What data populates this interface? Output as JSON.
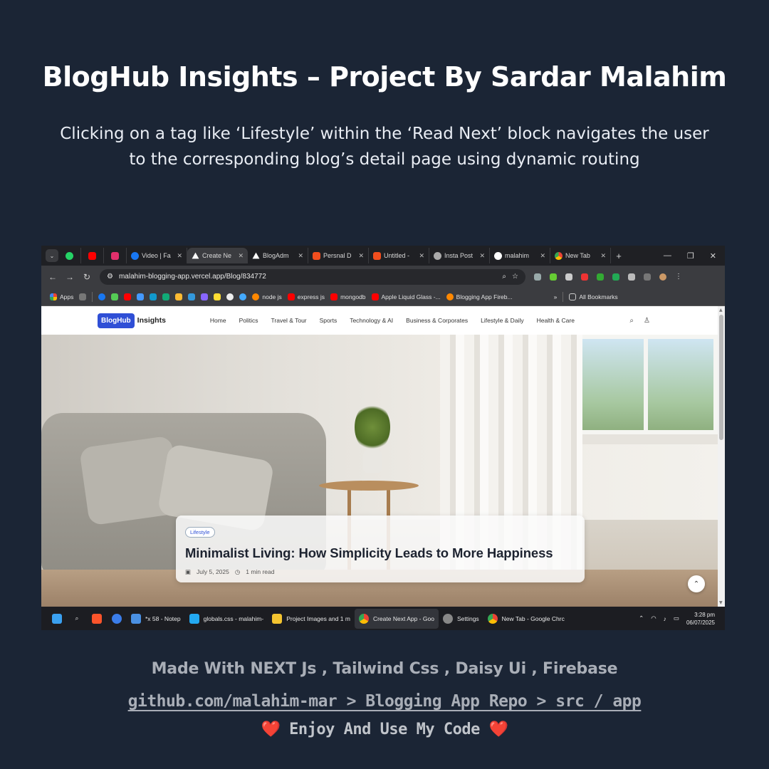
{
  "poster": {
    "title": "BlogHub Insights – Project By Sardar Malahim",
    "subtitle": "Clicking on a tag like ‘Lifestyle’ within the ‘Read Next’ block navigates the user to the corresponding blog’s detail page using dynamic routing",
    "stack_line": "Made With NEXT Js , Tailwind Css  , Daisy Ui , Firebase",
    "repo_path": "github.com/malahim-mar > Blogging App Repo > src / app",
    "enjoy_text": "Enjoy And Use My Code",
    "heart": "❤️"
  },
  "browser": {
    "tabs": [
      {
        "label": "",
        "icon": "whatsapp-icon",
        "color": "#25d366"
      },
      {
        "label": "",
        "icon": "youtube-icon",
        "color": "#ff0000"
      },
      {
        "label": "",
        "icon": "instagram-icon",
        "color": "#e1306c"
      },
      {
        "label": "Video | Fa",
        "icon": "facebook-icon",
        "color": "#1877f2"
      },
      {
        "label": "Create Ne",
        "icon": "vercel-icon",
        "color": "#000000",
        "active": true
      },
      {
        "label": "BlogAdm",
        "icon": "vercel-icon",
        "color": "#000000"
      },
      {
        "label": "Persnal D",
        "icon": "figma-icon",
        "color": "#f24e1e"
      },
      {
        "label": "Untitled -",
        "icon": "figma-icon",
        "color": "#f24e1e"
      },
      {
        "label": "Insta Post",
        "icon": "threads-icon",
        "color": "#aaaaaa"
      },
      {
        "label": "malahim",
        "icon": "github-icon",
        "color": "#ffffff"
      },
      {
        "label": "New Tab",
        "icon": "chrome-icon",
        "color": "#4285f4"
      }
    ],
    "url": "malahim-blogging-app.vercel.app/Blog/834772",
    "bookmarks": {
      "apps_label": "Apps",
      "items": [
        "node js",
        "express js",
        "mongodb",
        "Apple Liquid Glass -...",
        "Blogging App Fireb..."
      ],
      "all_bookmarks": "All Bookmarks"
    }
  },
  "site": {
    "logo_badge": "BlogHub",
    "logo_text": "Insights",
    "menu": [
      "Home",
      "Politics",
      "Travel & Tour",
      "Sports",
      "Technology & AI",
      "Business & Corporates",
      "Lifestyle & Daily",
      "Health & Care"
    ],
    "hero": {
      "tag": "Lifestyle",
      "title": "Minimalist Living: How Simplicity Leads to More Happiness",
      "date": "July 5, 2025",
      "read_time": "1 min read"
    }
  },
  "taskbar": {
    "items": [
      {
        "label": "*x 58 - Notep",
        "color": "#4a90e2"
      },
      {
        "label": "globals.css - malahim-",
        "color": "#23a9f2"
      },
      {
        "label": "Project Images and 1 m",
        "color": "#f4c430"
      },
      {
        "label": "Create Next App - Goo",
        "color": "#4285f4",
        "active": true
      },
      {
        "label": "Settings",
        "color": "#888888"
      },
      {
        "label": "New Tab - Google Chrc",
        "color": "#4285f4"
      }
    ],
    "time": "3:28 pm",
    "date": "06/07/2025"
  }
}
